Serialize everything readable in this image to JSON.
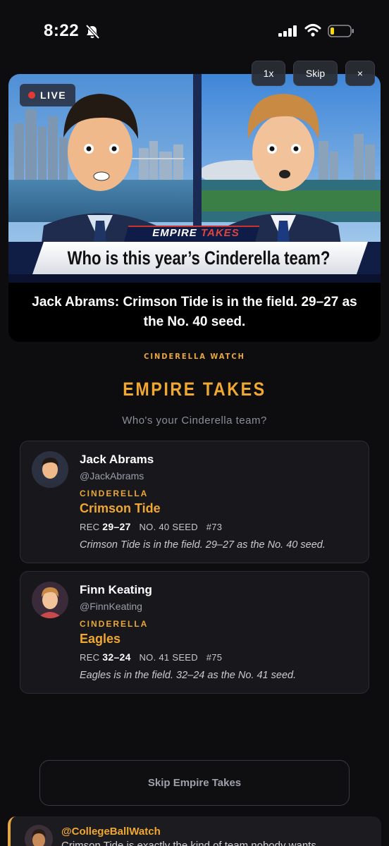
{
  "status": {
    "time": "8:22"
  },
  "video": {
    "live_label": "LIVE",
    "speed_label": "1x",
    "skip_label": "Skip",
    "close_label": "×",
    "banner_brand_main": "EMPIRE",
    "banner_brand_accent": "TAKES",
    "banner_question": "Who is this year’s Cinderella team?",
    "caption": "Jack Abrams: Crimson Tide is in the field. 29–27 as the No. 40 seed."
  },
  "section": {
    "kicker": "CINDERELLA WATCH",
    "title": "EMPIRE TAKES",
    "subtitle": "Who's your Cinderella team?"
  },
  "takes": [
    {
      "name": "Jack Abrams",
      "handle": "@JackAbrams",
      "tag": "CINDERELLA",
      "team": "Crimson Tide",
      "rec_label": "REC",
      "record": "29–27",
      "seed": "NO. 40 SEED",
      "rank": "#73",
      "blurb": "Crimson Tide is in the field. 29–27 as the No. 40 seed."
    },
    {
      "name": "Finn Keating",
      "handle": "@FinnKeating",
      "tag": "CINDERELLA",
      "team": "Eagles",
      "rec_label": "REC",
      "record": "32–24",
      "seed": "NO. 41 SEED",
      "rank": "#75",
      "blurb": "Eagles is in the field. 32–24 as the No. 41 seed."
    }
  ],
  "skip_button": "Skip Empire Takes",
  "feed_preview": {
    "handle": "@CollegeBallWatch",
    "text": "Crimson Tide is exactly the kind of team nobody wants"
  },
  "colors": {
    "accent": "#f0a830",
    "live": "#e53935",
    "background": "#0d0d10",
    "card": "#18181c"
  }
}
